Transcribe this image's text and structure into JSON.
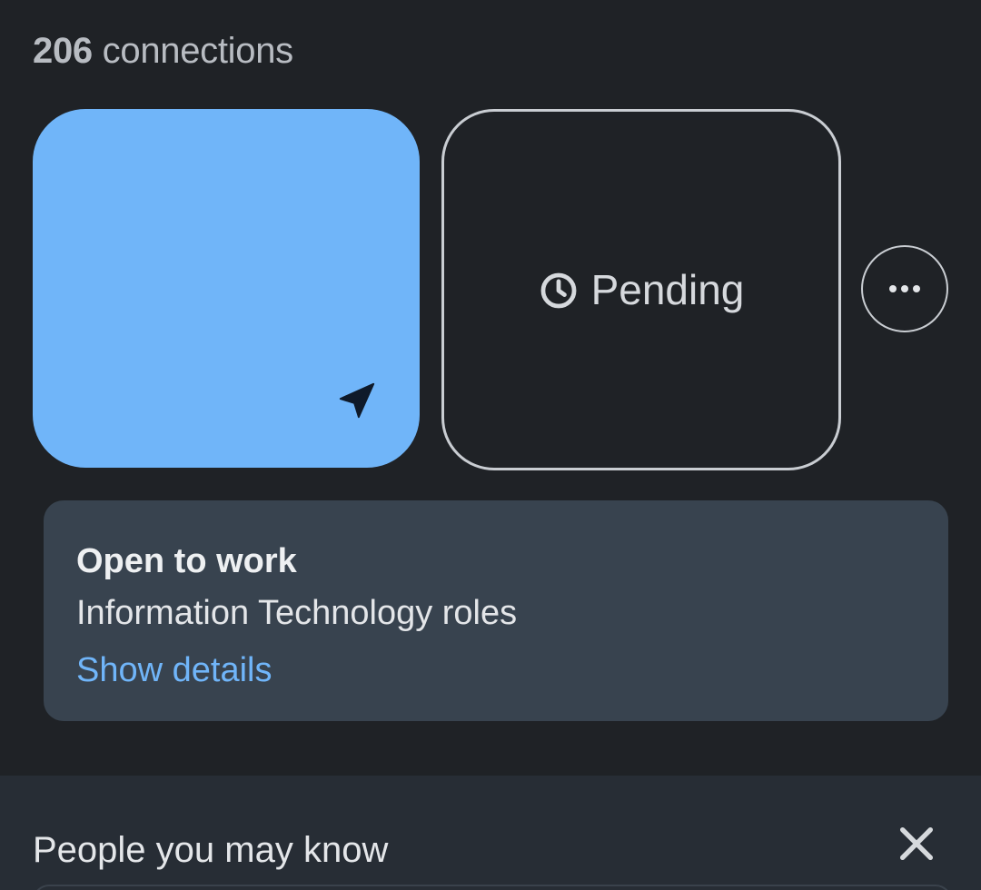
{
  "profile": {
    "connections_count": "206",
    "connections_label": "connections"
  },
  "actions": {
    "message_icon": "send-icon",
    "pending_icon": "clock-icon",
    "pending_label": "Pending",
    "more_icon": "more-horizontal-icon"
  },
  "open_to_work": {
    "title": "Open to work",
    "subtitle": "Information Technology roles",
    "link": "Show details"
  },
  "people_you_may_know": {
    "title": "People you may know",
    "close_icon": "close-icon"
  },
  "colors": {
    "background": "#1f2226",
    "primary_button": "#70b5f9",
    "card": "#38434f",
    "link": "#70b5f9",
    "section": "#272d35"
  }
}
